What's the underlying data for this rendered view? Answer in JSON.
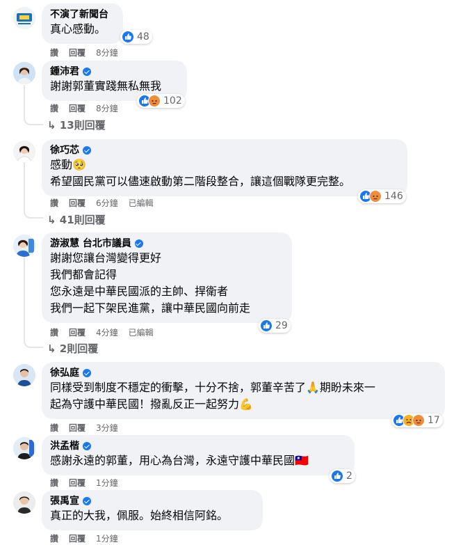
{
  "comments": [
    {
      "name": "不演了新聞台",
      "verified": false,
      "lines": [
        "真心感動。"
      ],
      "reactions": {
        "count": "48",
        "types": [
          "like"
        ]
      },
      "actions": [
        "讚",
        "回覆",
        "8分鐘"
      ]
    },
    {
      "name": "鍾沛君",
      "verified": true,
      "lines": [
        "謝謝郭董實踐無私無我"
      ],
      "reactions": {
        "count": "102",
        "types": [
          "like",
          "angry"
        ]
      },
      "actions": [
        "讚",
        "回覆",
        "8分鐘"
      ],
      "replies": "13則回覆"
    },
    {
      "name": "徐巧芯",
      "verified": true,
      "lines": [
        "感動🥺",
        "希望國民黨可以儘速啟動第二階段整合，讓這個戰隊更完整。"
      ],
      "reactions": {
        "count": "146",
        "types": [
          "like",
          "angry"
        ]
      },
      "actions": [
        "讚",
        "回覆",
        "6分鐘",
        "已編輯"
      ],
      "replies": "41則回覆"
    },
    {
      "name": "游淑慧 台北市議員",
      "verified": true,
      "lines": [
        "謝謝您讓台灣變得更好",
        "我們都會記得",
        "您永遠是中華民國派的主帥、捍衛者",
        "我們一起下架民進黨，讓中華民國向前走"
      ],
      "reactions": {
        "count": "29",
        "types": [
          "like"
        ]
      },
      "actions": [
        "讚",
        "回覆",
        "4分鐘",
        "已編輯"
      ],
      "replies": "2則回覆"
    },
    {
      "name": "徐弘庭",
      "verified": true,
      "lines": [
        "同樣受到制度不穩定的衝擊，十分不捨，郭董辛苦了🙏期盼未來一",
        "起為守護中華民國！撥亂反正一起努力💪"
      ],
      "reactions": {
        "count": "17",
        "types": [
          "like",
          "sad",
          "angry"
        ]
      },
      "actions": [
        "讚",
        "回覆",
        "3分鐘"
      ]
    },
    {
      "name": "洪孟楷",
      "verified": true,
      "lines": [
        "感謝永遠的郭董，用心為台灣，永遠守護中華民國🇹🇼"
      ],
      "reactions": {
        "count": "2",
        "types": [
          "like"
        ]
      },
      "actions": [
        "讚",
        "回覆",
        "1分鐘"
      ]
    },
    {
      "name": "張禹宣",
      "verified": true,
      "lines": [
        "真正的大我，佩服。始終相信阿銘。"
      ],
      "reactions": {
        "count": "",
        "types": []
      },
      "actions": [
        "讚",
        "回覆",
        "1分鐘"
      ]
    }
  ],
  "icons": {
    "like": "thumbs-up-icon",
    "angry": "angry-face-icon",
    "sad": "sad-face-icon",
    "reply": "reply-arrow-icon",
    "verified": "verified-badge-icon"
  },
  "colors": {
    "like": "#1877f2",
    "angry": "#f08d3c",
    "bubble": "#f0f2f5",
    "meta": "#65676b"
  }
}
